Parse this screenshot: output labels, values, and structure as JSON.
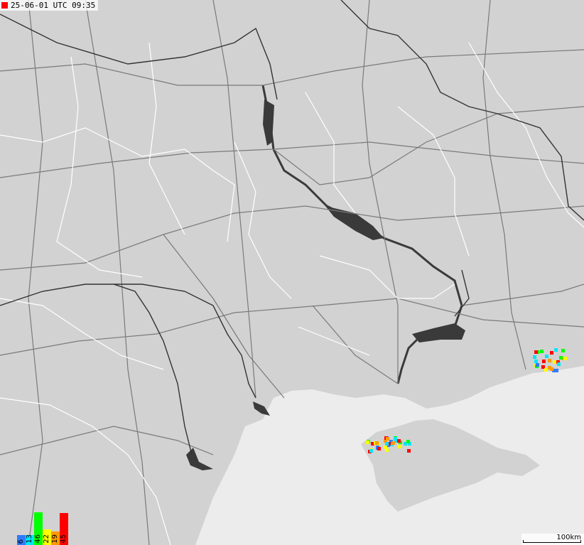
{
  "map": {
    "timestamp": "25-06-01 UTC 09:35",
    "timestamp_marker_color": "#ff0000",
    "land_color": "#d2d2d2",
    "sea_color": "#ececec",
    "water_color": "#3a3a3a",
    "road_color": "#7a7a7a",
    "border_color": "#ffffff",
    "legend": [
      {
        "value": "6",
        "color": "#2f7bff"
      },
      {
        "value": "13",
        "color": "#00e5ff"
      },
      {
        "value": "46",
        "color": "#00ff00"
      },
      {
        "value": "22",
        "color": "#ffff00"
      },
      {
        "value": "19",
        "color": "#ff9900"
      },
      {
        "value": "45",
        "color": "#ff0000"
      }
    ],
    "scale_label": "100km"
  }
}
